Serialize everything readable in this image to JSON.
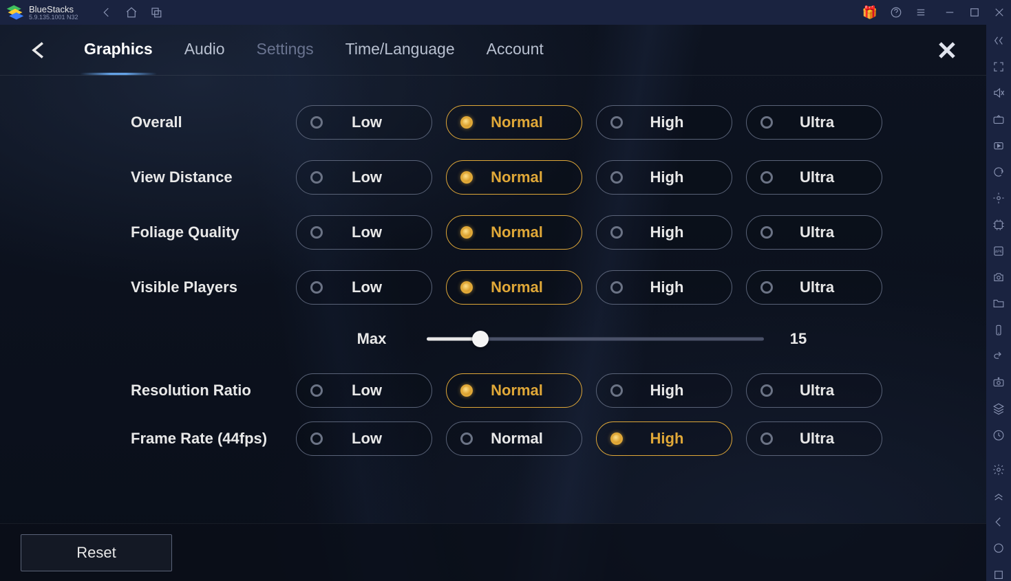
{
  "app": {
    "name": "BlueStacks",
    "version": "5.9.135.1001  N32"
  },
  "tabs": {
    "items": [
      {
        "label": "Graphics",
        "active": true
      },
      {
        "label": "Audio",
        "active": false
      },
      {
        "label": "Settings",
        "active": false,
        "dim": true
      },
      {
        "label": "Time/Language",
        "active": false
      },
      {
        "label": "Account",
        "active": false
      }
    ]
  },
  "options": [
    "Low",
    "Normal",
    "High",
    "Ultra"
  ],
  "settings": [
    {
      "key": "overall",
      "label": "Overall",
      "selected": 1
    },
    {
      "key": "view_distance",
      "label": "View Distance",
      "selected": 1
    },
    {
      "key": "foliage_quality",
      "label": "Foliage Quality",
      "selected": 1
    },
    {
      "key": "visible_players",
      "label": "Visible Players",
      "selected": 1
    },
    {
      "key": "resolution_ratio",
      "label": "Resolution Ratio",
      "selected": 1
    },
    {
      "key": "frame_rate",
      "label": "Frame Rate (44fps)",
      "selected": 2
    }
  ],
  "slider": {
    "label": "Max",
    "value": "15",
    "percent": 16
  },
  "footer": {
    "reset": "Reset"
  }
}
